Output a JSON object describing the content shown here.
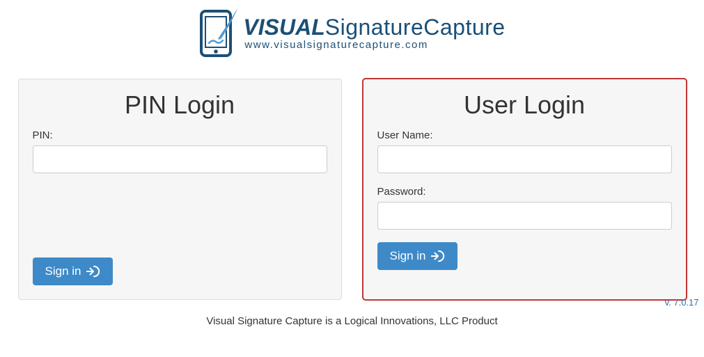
{
  "logo": {
    "visual": "VISUAL",
    "rest": "SignatureCapture",
    "url": "www.visualsignaturecapture.com"
  },
  "pin_panel": {
    "title": "PIN Login",
    "pin_label": "PIN:",
    "pin_value": "",
    "signin_label": "Sign in"
  },
  "user_panel": {
    "title": "User Login",
    "user_label": "User Name:",
    "user_value": "",
    "password_label": "Password:",
    "password_value": "",
    "signin_label": "Sign in"
  },
  "footer": {
    "text": "Visual Signature Capture is a Logical Innovations, LLC Product",
    "version": "v. 7.0.17"
  }
}
